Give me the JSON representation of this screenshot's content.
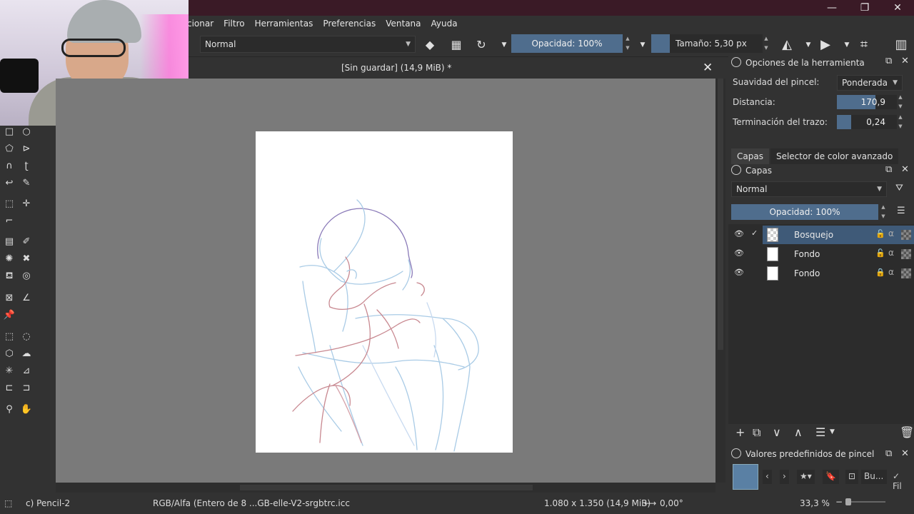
{
  "menu": {
    "items": [
      "cionar",
      "Filtro",
      "Herramientas",
      "Preferencias",
      "Ventana",
      "Ayuda"
    ]
  },
  "window_controls": {
    "minimize": "—",
    "restore": "❐",
    "close": "✕"
  },
  "toolbar": {
    "blend_mode": "Normal",
    "opacity_label": "Opacidad: 100%",
    "size_label": "Tamaño: 5,30 px"
  },
  "document": {
    "title": "[Sin guardar]  (14,9 MiB) *",
    "close": "✕"
  },
  "tool_options": {
    "title": "Opciones de la herramienta",
    "smoothing_label": "Suavidad del pincel:",
    "smoothing_value": "Ponderada",
    "distance_label": "Distancia:",
    "distance_value": "170,9",
    "distance_fill": 0.64,
    "stroke_end_label": "Terminación del trazo:",
    "stroke_end_value": "0,24",
    "stroke_end_fill": 0.24
  },
  "dock_tabs": [
    "Capas",
    "Selector de color avanzado"
  ],
  "layers": {
    "title": "Capas",
    "blend_mode": "Normal",
    "opacity_label": "Opacidad:  100%",
    "items": [
      {
        "name": "Bosquejo",
        "selected": true,
        "locked": false
      },
      {
        "name": "Fondo",
        "selected": false,
        "locked": false
      },
      {
        "name": "Fondo",
        "selected": false,
        "locked": true
      }
    ]
  },
  "brush_presets": {
    "title": "Valores predefinidos de pincel",
    "search_placeholder": "Bu...",
    "filter_label": "Fil"
  },
  "status": {
    "brush": "c) Pencil-2",
    "color_profile": "RGB/Alfa (Entero de 8 ...GB-elle-V2-srgbtrc.icc",
    "dimensions": "1.080 x 1.350 (14,9 MiB)",
    "rotation": "0,00°",
    "zoom": "33,3 %"
  },
  "colors": {
    "accent": "#4f6d8d",
    "sketch_blue": "#9ec6e6",
    "sketch_red": "#c88890",
    "sketch_purple": "#8a7ab8"
  }
}
